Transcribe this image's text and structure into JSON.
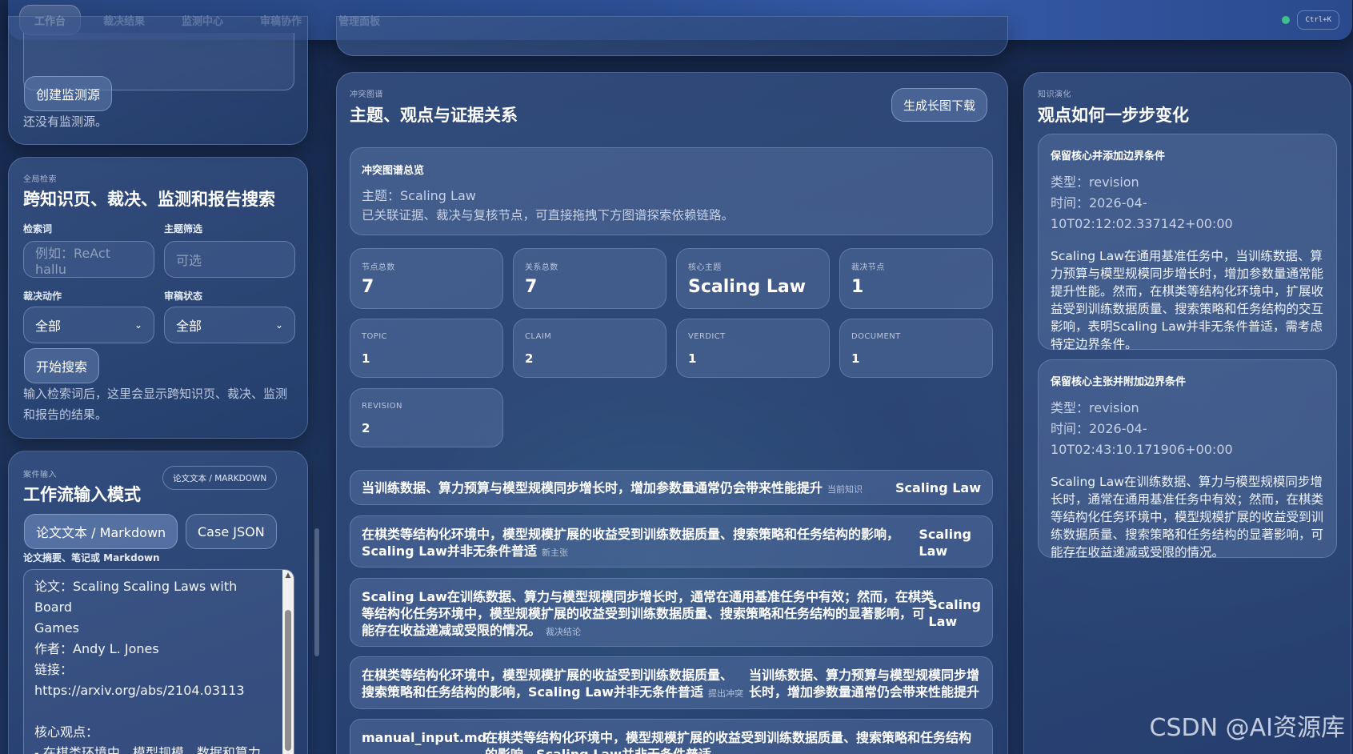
{
  "nav": {
    "tabs": [
      {
        "label": "工作台"
      },
      {
        "label": "裁决结果"
      },
      {
        "label": "监测中心"
      },
      {
        "label": "审稿协作"
      },
      {
        "label": "管理面板"
      }
    ],
    "shortcut": "Ctrl+K"
  },
  "monitor": {
    "create_button": "创建监测源",
    "empty_text": "还没有监测源。"
  },
  "search": {
    "eyebrow": "全局检索",
    "title": "跨知识页、裁决、监测和报告搜索",
    "keyword_label": "检索词",
    "keyword_placeholder": "例如：ReAct hallu",
    "topic_label": "主题筛选",
    "topic_placeholder": "可选",
    "action_label": "裁决动作",
    "action_value": "全部",
    "status_label": "审稿状态",
    "status_value": "全部",
    "start_button": "开始搜索",
    "hint": "输入检索词后，这里会显示跨知识页、裁决、监测和报告的结果。"
  },
  "input": {
    "eyebrow": "案件输入",
    "title": "工作流输入模式",
    "mode_badge": "论文文本 / MARKDOWN",
    "mode_tabs": [
      {
        "label": "论文文本 / Markdown"
      },
      {
        "label": "Case JSON"
      }
    ],
    "field_label": "论文摘要、笔记或 Markdown",
    "text_lines": [
      "论文：Scaling Scaling Laws with Board",
      "Games",
      "作者：Andy L. Jones",
      "链接：",
      "https://arxiv.org/abs/2104.03113",
      "",
      "核心观点：",
      "- 在棋类环境中，模型规模、数据和算力"
    ]
  },
  "graph": {
    "eyebrow": "冲突图谱",
    "title": "主题、观点与证据关系",
    "download_button": "生成长图下载",
    "overview_title": "冲突图谱总览",
    "overview_topic": "主题：Scaling Law",
    "overview_desc": "已关联证据、裁决与复核节点，可直接拖拽下方图谱探索依赖链路。",
    "stats": [
      {
        "label": "节点总数",
        "value": "7"
      },
      {
        "label": "关系总数",
        "value": "7"
      },
      {
        "label": "核心主题",
        "value": "Scaling Law"
      },
      {
        "label": "裁决节点",
        "value": "1"
      }
    ],
    "types": [
      {
        "label": "TOPIC",
        "value": "1"
      },
      {
        "label": "CLAIM",
        "value": "2"
      },
      {
        "label": "VERDICT",
        "value": "1"
      },
      {
        "label": "DOCUMENT",
        "value": "1"
      },
      {
        "label": "REVISION",
        "value": "2"
      }
    ],
    "rows": [
      {
        "lines": [
          "当训练数据、算力预算与模型规模同步增长时，增加参数量通常仍会带来性能提升"
        ],
        "tag": "当前知识",
        "topic_lines": [
          "Scaling Law"
        ]
      },
      {
        "lines": [
          "在棋类等结构化环境中，模型规模扩展的收益受到训练数据质量、搜索策略和任务结构的影响，",
          "Scaling Law并非无条件普适"
        ],
        "tag": "新主张",
        "topic_lines": [
          "Scaling",
          "Law"
        ]
      },
      {
        "lines": [
          "Scaling Law在训练数据、算力与模型规模同步增长时，通常在通用基准任务中有效；然而，在棋类",
          "等结构化任务环境中，模型规模扩展的收益受到训练数据质量、搜索策略和任务结构的显著影响，可",
          "能存在收益递减或受限的情况。"
        ],
        "tag": "裁决结论",
        "topic_lines": [
          "Scaling",
          "Law"
        ]
      },
      {
        "lines": [
          "在棋类等结构化环境中，模型规模扩展的收益受到训练数据质量、",
          "搜索策略和任务结构的影响，Scaling Law并非无条件普适"
        ],
        "tag": "提出冲突",
        "topic_lines": [
          "当训练数据、算力预算与模型规模同步增",
          "长时，增加参数量通常仍会带来性能提升"
        ]
      },
      {
        "lines": [
          "manual_input.md"
        ],
        "tag": "",
        "topic_lines": [
          "在棋类等结构化环境中，模型规模扩展的收益受到训练数据质量、搜索策略和任务结构",
          "的影响，Scaling Law并非无条件普适"
        ]
      }
    ]
  },
  "evolution": {
    "eyebrow": "知识演化",
    "title": "观点如何一步步变化",
    "items": [
      {
        "title": "保留核心并添加边界条件",
        "type": "类型：revision",
        "time": "时间：2026-04-10T02:12:02.337142+00:00",
        "body": "Scaling Law在通用基准任务中，当训练数据、算力预算与模型规模同步增长时，增加参数量通常能提升性能。然而，在棋类等结构化环境中，扩展收益受到训练数据质量、搜索策略和任务结构的交互影响，表明Scaling Law并非无条件普适，需考虑特定边界条件。"
      },
      {
        "title": "保留核心主张并附加边界条件",
        "type": "类型：revision",
        "time": "时间：2026-04-10T02:43:10.171906+00:00",
        "body": "Scaling Law在训练数据、算力与模型规模同步增长时，通常在通用基准任务中有效；然而，在棋类等结构化任务环境中，模型规模扩展的收益受到训练数据质量、搜索策略和任务结构的显著影响，可能存在收益递减或受限的情况。"
      }
    ]
  },
  "watermark": "CSDN @AI资源库"
}
